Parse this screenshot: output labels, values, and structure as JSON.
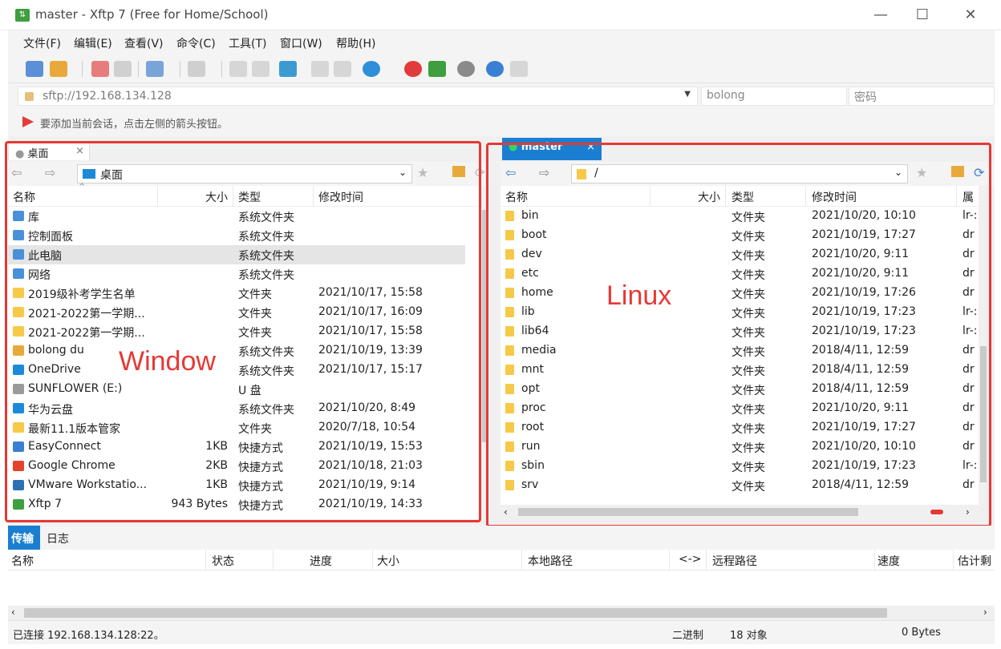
{
  "window": {
    "title": "master - Xftp 7 (Free for Home/School)",
    "app_icon": "Xftp-app-icon",
    "minimize": "—",
    "maximize": "☐",
    "close": "✕"
  },
  "menu": [
    "文件(F)",
    "编辑(E)",
    "查看(V)",
    "命令(C)",
    "工具(T)",
    "窗口(W)",
    "帮助(H)"
  ],
  "address": {
    "url": "sftp://192.168.134.128",
    "user": "bolong",
    "password_placeholder": "密码"
  },
  "hint": "要添加当前会话，点击左侧的箭头按钮。",
  "left": {
    "tab": "桌面",
    "tab_close": "×",
    "path": "桌面",
    "headers": {
      "name": "名称",
      "size": "大小",
      "type": "类型",
      "modified": "修改时间"
    },
    "rows": [
      {
        "name": "库",
        "size": "",
        "type": "系统文件夹",
        "modified": "",
        "icon": "library"
      },
      {
        "name": "控制面板",
        "size": "",
        "type": "系统文件夹",
        "modified": "",
        "icon": "control-panel"
      },
      {
        "name": "此电脑",
        "size": "",
        "type": "系统文件夹",
        "modified": "",
        "icon": "computer"
      },
      {
        "name": "网络",
        "size": "",
        "type": "系统文件夹",
        "modified": "",
        "icon": "network"
      },
      {
        "name": "2019级补考学生名单",
        "size": "",
        "type": "文件夹",
        "modified": "2021/10/17, 15:58",
        "icon": "folder"
      },
      {
        "name": "2021-2022第一学期...",
        "size": "",
        "type": "文件夹",
        "modified": "2021/10/17, 16:09",
        "icon": "folder"
      },
      {
        "name": "2021-2022第一学期...",
        "size": "",
        "type": "文件夹",
        "modified": "2021/10/17, 15:58",
        "icon": "folder"
      },
      {
        "name": "bolong du",
        "size": "",
        "type": "系统文件夹",
        "modified": "2021/10/19, 13:39",
        "icon": "user"
      },
      {
        "name": "OneDrive",
        "size": "",
        "type": "系统文件夹",
        "modified": "2021/10/17, 15:17",
        "icon": "onedrive"
      },
      {
        "name": "SUNFLOWER (E:)",
        "size": "",
        "type": "U 盘",
        "modified": "",
        "icon": "usb"
      },
      {
        "name": "华为云盘",
        "size": "",
        "type": "系统文件夹",
        "modified": "2021/10/20, 8:49",
        "icon": "cloud"
      },
      {
        "name": "最新11.1版本管家",
        "size": "",
        "type": "文件夹",
        "modified": "2020/7/18, 10:54",
        "icon": "folder"
      },
      {
        "name": "EasyConnect",
        "size": "1KB",
        "type": "快捷方式",
        "modified": "2021/10/19, 15:53",
        "icon": "shortcut"
      },
      {
        "name": "Google Chrome",
        "size": "2KB",
        "type": "快捷方式",
        "modified": "2021/10/18, 21:03",
        "icon": "chrome"
      },
      {
        "name": "VMware Workstatio...",
        "size": "1KB",
        "type": "快捷方式",
        "modified": "2021/10/19, 9:14",
        "icon": "vmware"
      },
      {
        "name": "Xftp 7",
        "size": "943 Bytes",
        "type": "快捷方式",
        "modified": "2021/10/19, 14:33",
        "icon": "xftp"
      }
    ],
    "annotation": "Window"
  },
  "right": {
    "tab": "master",
    "tab_close": "×",
    "path": "/",
    "headers": {
      "name": "名称",
      "size": "大小",
      "type": "类型",
      "modified": "修改时间",
      "attr": "属性"
    },
    "rows": [
      {
        "name": "bin",
        "type": "文件夹",
        "modified": "2021/10/20, 10:10",
        "attr": "lr-:",
        "link": true
      },
      {
        "name": "boot",
        "type": "文件夹",
        "modified": "2021/10/19, 17:27",
        "attr": "dr",
        "link": false
      },
      {
        "name": "dev",
        "type": "文件夹",
        "modified": "2021/10/20, 9:11",
        "attr": "dr",
        "link": false
      },
      {
        "name": "etc",
        "type": "文件夹",
        "modified": "2021/10/20, 9:11",
        "attr": "dr",
        "link": false
      },
      {
        "name": "home",
        "type": "文件夹",
        "modified": "2021/10/19, 17:26",
        "attr": "dr",
        "link": false
      },
      {
        "name": "lib",
        "type": "文件夹",
        "modified": "2021/10/19, 17:23",
        "attr": "lr-:",
        "link": true
      },
      {
        "name": "lib64",
        "type": "文件夹",
        "modified": "2021/10/19, 17:23",
        "attr": "lr-:",
        "link": true
      },
      {
        "name": "media",
        "type": "文件夹",
        "modified": "2018/4/11, 12:59",
        "attr": "dr",
        "link": false
      },
      {
        "name": "mnt",
        "type": "文件夹",
        "modified": "2018/4/11, 12:59",
        "attr": "dr",
        "link": false
      },
      {
        "name": "opt",
        "type": "文件夹",
        "modified": "2018/4/11, 12:59",
        "attr": "dr",
        "link": false
      },
      {
        "name": "proc",
        "type": "文件夹",
        "modified": "2021/10/20, 9:11",
        "attr": "dr",
        "link": false
      },
      {
        "name": "root",
        "type": "文件夹",
        "modified": "2021/10/19, 17:27",
        "attr": "dr",
        "link": false
      },
      {
        "name": "run",
        "type": "文件夹",
        "modified": "2021/10/20, 10:10",
        "attr": "dr",
        "link": false
      },
      {
        "name": "sbin",
        "type": "文件夹",
        "modified": "2021/10/19, 17:23",
        "attr": "lr-:",
        "link": true
      },
      {
        "name": "srv",
        "type": "文件夹",
        "modified": "2018/4/11, 12:59",
        "attr": "dr",
        "link": false
      }
    ],
    "annotation": "Linux"
  },
  "bottom_tabs": [
    "传输",
    "日志"
  ],
  "transfer_headers": [
    "名称",
    "状态",
    "进度",
    "大小",
    "本地路径",
    "<->",
    "远程路径",
    "速度",
    "估计剩"
  ],
  "status": {
    "connection": "已连接 192.168.134.128:22。",
    "mode": "二进制",
    "objects": "18 对象",
    "bytes": "0 Bytes"
  },
  "colors": {
    "accent": "#1a7fd0",
    "annotation": "#e53935",
    "folder": "#f7c948",
    "selected_row": "#e5e5e5"
  }
}
